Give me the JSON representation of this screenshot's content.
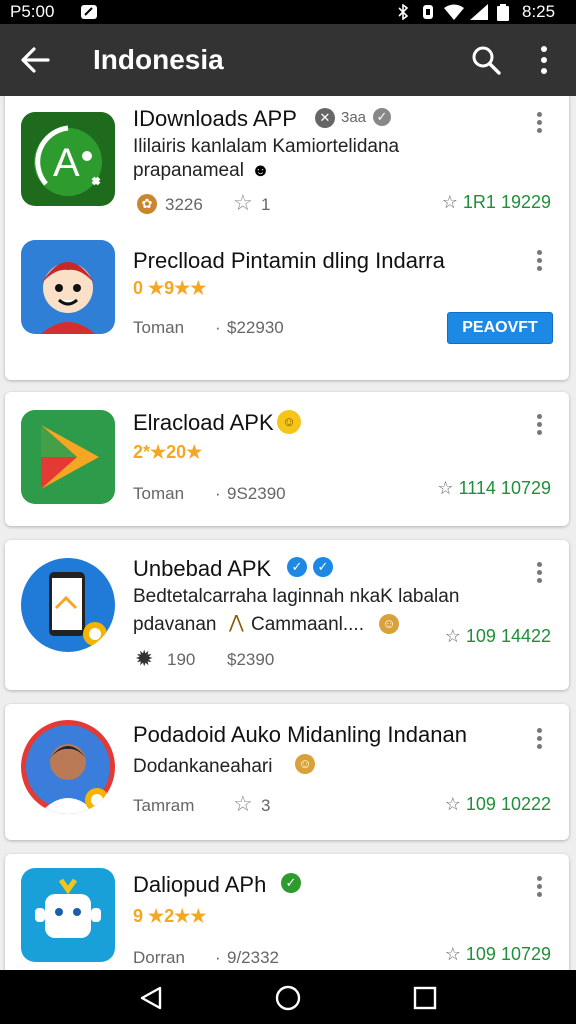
{
  "status": {
    "time": "P5:00",
    "clock": "8:25"
  },
  "appbar": {
    "title": "Indonesia"
  },
  "apps": [
    {
      "name": "IDownloads APP",
      "desc1": "Ililairis kanlalam Kamiortelidana",
      "desc2": "prapanameal",
      "meta1": "3226",
      "meta2": "1",
      "downloads": "1R1 19229"
    },
    {
      "name": "Preclload Pintamin dling Indarra",
      "rating": "0 ★9★★",
      "meta1": "Toman",
      "meta2": "$22930",
      "button": "PEAOVFT"
    },
    {
      "name": "Elracload APK",
      "rating": "2*★20★",
      "meta1": "Toman",
      "meta2": "9S2390",
      "downloads": "1114 10729"
    },
    {
      "name": "Unbebad APK",
      "desc1": "Bedtetalcarraha laginnah nkaK labalan",
      "desc2": "pdavanan",
      "desc3": "Cammaanl....",
      "meta1": "190",
      "meta2": "$2390",
      "downloads": "109 14422"
    },
    {
      "name": "Podadoid Auko Midanling Indanan",
      "desc1": "Dodankaneahari",
      "meta1": "Tamram",
      "meta2": "3",
      "downloads": "109 10222"
    },
    {
      "name": "Daliopud APh",
      "rating": "9 ★2★★",
      "meta1": "Dorran",
      "meta2": "9/2332",
      "downloads": "109 10729"
    }
  ],
  "colors": {
    "appbar": "#333333",
    "download_green": "#1f8f3a",
    "rating_orange": "#f5a623",
    "button_blue": "#1e88e5"
  }
}
